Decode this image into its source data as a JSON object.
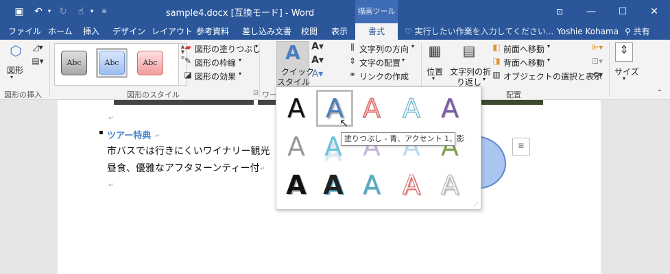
{
  "window": {
    "title": "sample4.docx [互換モード] - Word",
    "context_tab": "描画ツール",
    "qat": {
      "save_icon": "save-icon",
      "undo_icon": "undo-icon",
      "redo_icon": "redo-icon",
      "touch_icon": "touch-mode-icon",
      "customize_icon": "customize-icon"
    },
    "controls": {
      "ribbon_display": "ribbon-display-icon",
      "minimize": "minimize-icon",
      "maximize": "maximize-icon",
      "close": "close-icon"
    }
  },
  "tabs": [
    {
      "label": "ファイル"
    },
    {
      "label": "ホーム"
    },
    {
      "label": "挿入"
    },
    {
      "label": "デザイン"
    },
    {
      "label": "レイアウト"
    },
    {
      "label": "参考資料"
    },
    {
      "label": "差し込み文書"
    },
    {
      "label": "校閲"
    },
    {
      "label": "表示"
    },
    {
      "label": "書式"
    }
  ],
  "tell_me": "実行したい作業を入力してください...",
  "user": "Yoshie Kohama",
  "share": "共有",
  "ribbon": {
    "insert_shapes": {
      "shapes_label": "図形",
      "group_label": "図形の挿入"
    },
    "shape_styles": {
      "sample_text": "Abc",
      "fill": "図形の塗りつぶし",
      "outline": "図形の枠線",
      "effects": "図形の効果",
      "group_label": "図形のスタイル"
    },
    "wordart": {
      "quick_style_line1": "クイック",
      "quick_style_line2": "スタイル",
      "group_label_partial": "ワー"
    },
    "text": {
      "direction": "文字列の方向",
      "align": "文字の配置",
      "link": "リンクの作成"
    },
    "arrange": {
      "position": "位置",
      "wrap_line1": "文字列の折",
      "wrap_line2": "り返し",
      "bring_forward": "前面へ移動",
      "send_backward": "背面へ移動",
      "selection_pane": "オブジェクトの選択と表示",
      "group_label": "配置"
    },
    "size": {
      "label": "サイズ"
    }
  },
  "document": {
    "heading": "ツアー特典",
    "line1": "市バスでは行きにくいワイナリー観光",
    "line2": "昼食、優雅なアフタヌーンティー付",
    "para_mark": "↵",
    "bullet": "▪"
  },
  "wordart_gallery": {
    "glyph": "A",
    "tooltip": "塗りつぶし - 青、アクセント 1、影"
  },
  "colors": {
    "brand": "#2b579a",
    "accent_blue": "#4a7ebf",
    "heading_blue": "#4a86d0"
  }
}
